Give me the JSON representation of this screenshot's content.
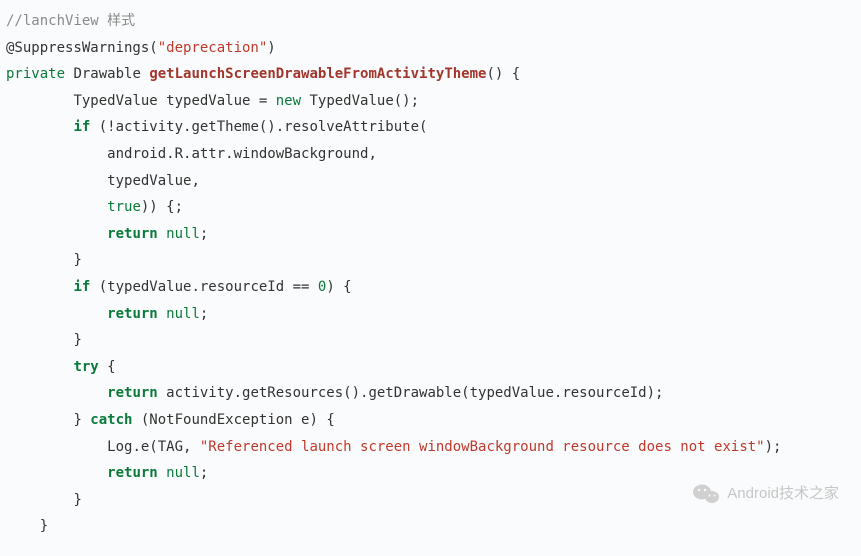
{
  "code": {
    "l01_comment": "//lanchView 样式",
    "l02": {
      "a": "@SuppressWarnings(",
      "str": "\"deprecation\"",
      "z": ")"
    },
    "l03": {
      "kw_private": "private",
      "type": " Drawable ",
      "fn": "getLaunchScreenDrawableFromActivityTheme",
      "tail": "() {"
    },
    "l04": {
      "indent": "        ",
      "text1": "TypedValue typedValue = ",
      "kw_new": "new",
      "text2": " TypedValue();"
    },
    "l05": {
      "indent": "        ",
      "kw_if": "if",
      "rest": " (!activity.getTheme().resolveAttribute("
    },
    "l06": {
      "indent": "            ",
      "text": "android.R.attr.windowBackground,"
    },
    "l07": {
      "indent": "            ",
      "text": "typedValue,"
    },
    "l08": {
      "indent": "            ",
      "kw_true": "true",
      "tail": ")) {;"
    },
    "l09": {
      "indent": "            ",
      "kw_return": "return",
      "sp": " ",
      "kw_null": "null",
      "tail": ";"
    },
    "l10": {
      "indent": "        ",
      "text": "}"
    },
    "l11": {
      "indent": "        ",
      "kw_if": "if",
      "text1": " (typedValue.resourceId == ",
      "num": "0",
      "text2": ") {"
    },
    "l12": {
      "indent": "            ",
      "kw_return": "return",
      "sp": " ",
      "kw_null": "null",
      "tail": ";"
    },
    "l13": {
      "indent": "        ",
      "text": "}"
    },
    "l14": {
      "indent": "        ",
      "kw_try": "try",
      "tail": " {"
    },
    "l15": {
      "indent": "            ",
      "kw_return": "return",
      "tail": " activity.getResources().getDrawable(typedValue.resourceId);"
    },
    "l16": {
      "indent": "        ",
      "a": "} ",
      "kw_catch": "catch",
      "b": " (NotFoundException e) {"
    },
    "l17": {
      "indent": "            ",
      "a": "Log.e(TAG, ",
      "str": "\"Referenced launch screen windowBackground resource does not exist\"",
      "z": ");"
    },
    "l18": {
      "indent": "            ",
      "kw_return": "return",
      "sp": " ",
      "kw_null": "null",
      "tail": ";"
    },
    "l19": {
      "indent": "        ",
      "text": "}"
    },
    "l20": {
      "indent": "    ",
      "text": "}"
    }
  },
  "watermark": {
    "text": "Android技术之家"
  }
}
